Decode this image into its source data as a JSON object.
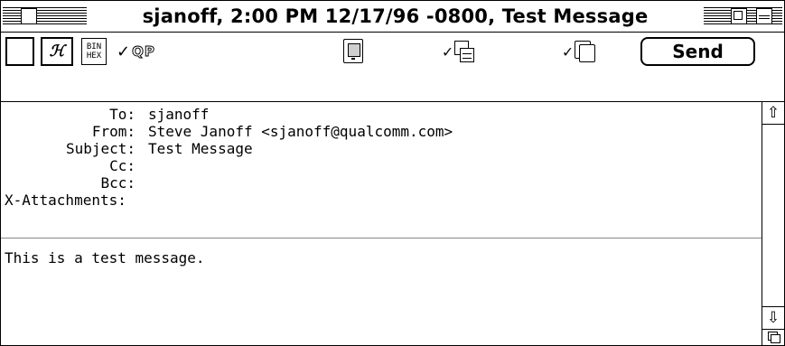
{
  "window": {
    "title": "sjanoff, 2:00 PM 12/17/96 -0800, Test Message"
  },
  "toolbar": {
    "signature_glyph": "ℋ",
    "binhex_line1": "BIN",
    "binhex_line2": "HEX",
    "qp_check": "✓",
    "qp_label": "QP",
    "keep_copy_check": "✓",
    "return_receipt_check": "✓",
    "send_label": "Send",
    "icons": [
      "priority-box",
      "signature-icon",
      "binhex-icon",
      "quoted-printable-toggle",
      "word-wrap-icon",
      "keep-copy-icon",
      "return-receipt-icon"
    ]
  },
  "headers": [
    {
      "label": "To:",
      "value": "sjanoff"
    },
    {
      "label": "From:",
      "value": "Steve Janoff <sjanoff@qualcomm.com>"
    },
    {
      "label": "Subject:",
      "value": "Test Message"
    },
    {
      "label": "Cc:",
      "value": ""
    },
    {
      "label": "Bcc:",
      "value": ""
    },
    {
      "label": "X-Attachments:",
      "value": ""
    }
  ],
  "body": {
    "text": "This is a test message."
  },
  "scrollbar": {
    "up_glyph": "⇧",
    "down_glyph": "⇩"
  }
}
